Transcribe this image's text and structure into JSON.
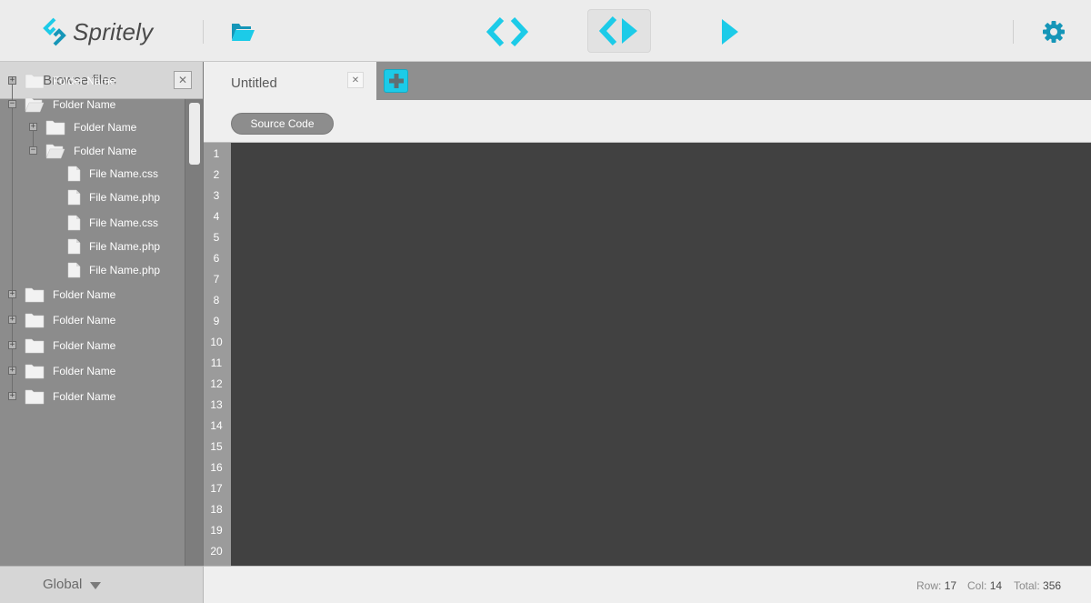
{
  "app": {
    "name": "Spritely"
  },
  "colors": {
    "accent": "#1ccbe8",
    "sidebar_bg": "#8c8c8c",
    "editor_bg": "#414141",
    "gutter_bg": "#9b9b9b"
  },
  "toolbar": {
    "open_icon": "folder-open-icon",
    "code_view_icon": "code-brackets-icon",
    "split_view_icon": "split-code-icon",
    "run_icon": "play-icon",
    "settings_icon": "gear-icon"
  },
  "sidebar": {
    "title": "Browse files",
    "close_symbol": "✕",
    "tree": [
      {
        "label": "Folder Name",
        "kind": "folder",
        "level": 0,
        "expanded": false,
        "expander": "+"
      },
      {
        "label": "Folder Name",
        "kind": "folder",
        "level": 0,
        "expanded": true,
        "expander": "−"
      },
      {
        "label": "Folder Name",
        "kind": "folder",
        "level": 1,
        "expanded": false,
        "expander": "+"
      },
      {
        "label": "Folder Name",
        "kind": "folder",
        "level": 1,
        "expanded": true,
        "expander": "−"
      },
      {
        "label": "File Name.css",
        "kind": "file",
        "level": 2
      },
      {
        "label": "File Name.php",
        "kind": "file",
        "level": 2
      },
      {
        "label": "File Name.css",
        "kind": "file",
        "level": 2
      },
      {
        "label": "File Name.php",
        "kind": "file",
        "level": 2
      },
      {
        "label": "File Name.php",
        "kind": "file",
        "level": 2
      },
      {
        "label": "Folder Name",
        "kind": "folder",
        "level": 0,
        "expanded": false,
        "expander": "+"
      },
      {
        "label": "Folder Name",
        "kind": "folder",
        "level": 0,
        "expanded": false,
        "expander": "+"
      },
      {
        "label": "Folder Name",
        "kind": "folder",
        "level": 0,
        "expanded": false,
        "expander": "+"
      },
      {
        "label": "Folder Name",
        "kind": "folder",
        "level": 0,
        "expanded": false,
        "expander": "+"
      },
      {
        "label": "Folder Name",
        "kind": "folder",
        "level": 0,
        "expanded": false,
        "expander": "+"
      }
    ],
    "footer_label": "Global"
  },
  "editor": {
    "tab_label": "Untitled",
    "tab_close_symbol": "✕",
    "add_tab_icon": "plus-icon",
    "view_mode": "Source Code",
    "line_numbers": [
      "1",
      "2",
      "3",
      "4",
      "5",
      "6",
      "7",
      "8",
      "9",
      "10",
      "11",
      "12",
      "13",
      "14",
      "15",
      "16",
      "17",
      "18",
      "19",
      "20"
    ]
  },
  "status": {
    "row_label": "Row:",
    "row_value": "17",
    "col_label": "Col:",
    "col_value": "14",
    "total_label": "Total:",
    "total_value": "356"
  }
}
